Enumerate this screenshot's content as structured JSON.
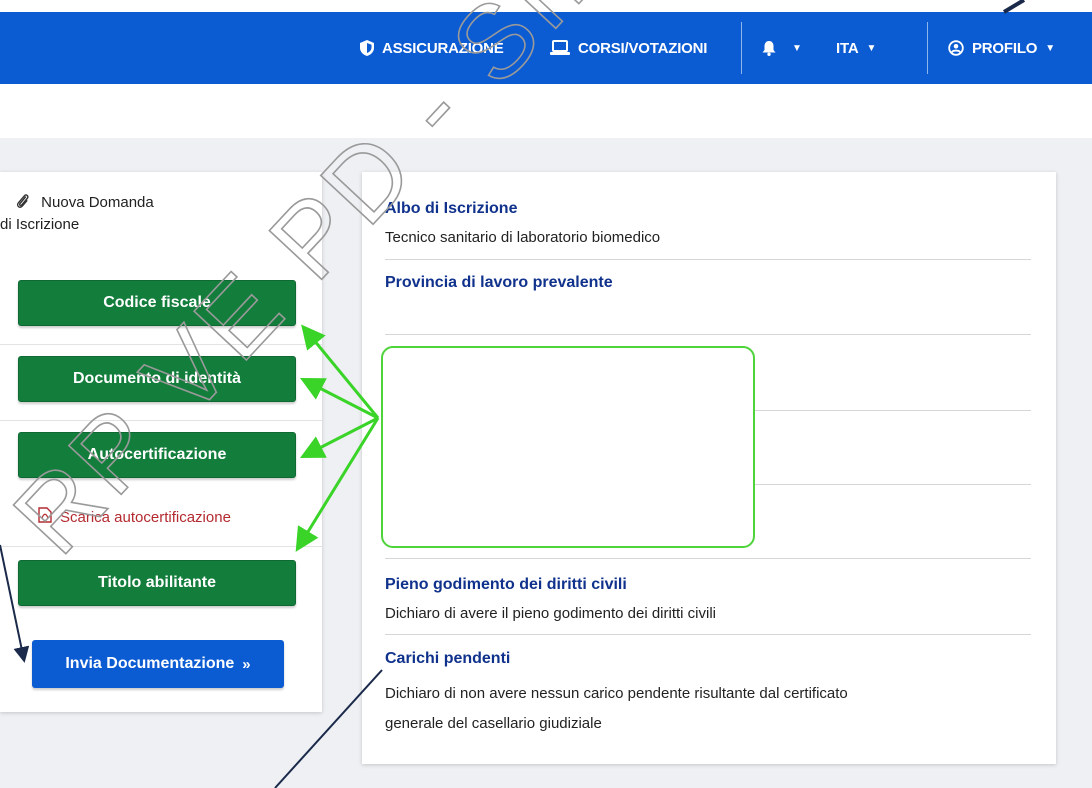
{
  "navbar": {
    "background_color": "#0b5bd3",
    "items": [
      {
        "label": "ASSICURAZIONE",
        "icon": "shield-icon"
      },
      {
        "label": "CORSI/VOTAZIONI",
        "icon": "laptop-icon"
      },
      {
        "label": "",
        "icon": "bell-icon",
        "has_dropdown": true
      },
      {
        "label": "ITA",
        "icon": "",
        "has_dropdown": true
      },
      {
        "label": "PROFILO",
        "icon": "user-circle-icon",
        "has_dropdown": true
      }
    ]
  },
  "watermark": {
    "text": "RP VE PD - SINTESI D"
  },
  "left_panel": {
    "title_line1": "Nuova Domanda",
    "title_line2": "di Iscrizione",
    "title_icon": "paperclip-icon",
    "buttons": [
      {
        "label": "Codice fiscale"
      },
      {
        "label": "Documento di identità"
      },
      {
        "label": "Autocertificazione"
      },
      {
        "label": "Titolo abilitante"
      }
    ],
    "download_link": {
      "label": "Scarica autocertificazione",
      "icon": "pdf-icon",
      "color": "#b32a2f"
    },
    "submit_button": {
      "label": "Invia Documentazione",
      "icon": "double-chevron-right-icon",
      "color": "#0b5bd3"
    },
    "button_color": "#137d3c"
  },
  "right_panel": {
    "label_color": "#10328c",
    "fields": [
      {
        "label": "Albo di Iscrizione",
        "value": "Tecnico sanitario di laboratorio biomedico"
      },
      {
        "label": "Provincia di lavoro prevalente",
        "value": ""
      },
      {
        "label": "Pieno godimento dei diritti civili",
        "value": "Dichiaro di avere il pieno godimento dei diritti civili"
      },
      {
        "label": "Carichi pendenti",
        "value_line1": "Dichiaro di non avere nessun carico pendente risultante dal certificato",
        "value_line2": "generale del casellario giudiziale"
      }
    ]
  },
  "annotations": {
    "highlight_color": "#4fd33b",
    "arrow_color": "#3ad428",
    "pointer_color": "#1b2a4a"
  }
}
